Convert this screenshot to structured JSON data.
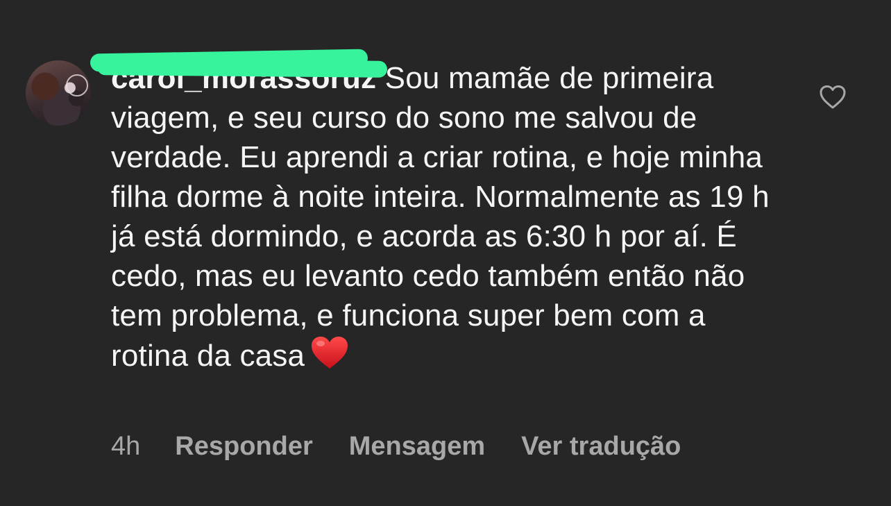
{
  "comment": {
    "username": "carol_morassoruz",
    "text": " Sou mamãe de primeira viagem, e seu curso do sono me salvou de verdade. Eu aprendi a criar rotina, e hoje minha filha dorme à noite inteira. Normalmente as 19 h já está dormindo, e acorda as 6:30 h por aí. É cedo, mas eu levanto cedo também então não tem problema, e funciona super bem com a rotina da casa",
    "emoji_icon": "red-heart-emoji",
    "like_icon": "heart-outline-icon",
    "redaction_color": "#37f39c"
  },
  "actions": {
    "time": "4h",
    "reply_label": "Responder",
    "message_label": "Mensagem",
    "translate_label": "Ver tradução"
  }
}
